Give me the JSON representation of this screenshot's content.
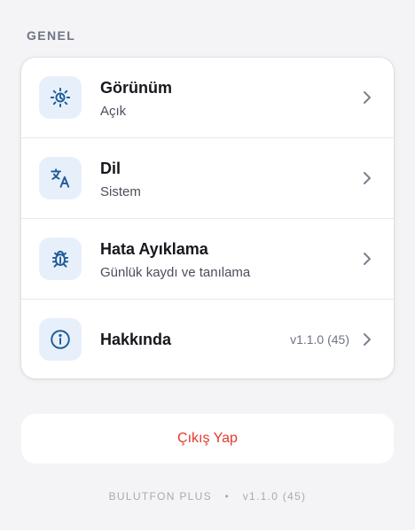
{
  "section": {
    "title": "GENEL"
  },
  "rows": [
    {
      "title": "Görünüm",
      "subtitle": "Açık",
      "icon": "theme-icon"
    },
    {
      "title": "Dil",
      "subtitle": "Sistem",
      "icon": "translate-icon"
    },
    {
      "title": "Hata Ayıklama",
      "subtitle": "Günlük kaydı ve tanılama",
      "icon": "bug-icon"
    },
    {
      "title": "Hakkında",
      "value": "v1.1.0 (45)",
      "icon": "info-icon"
    }
  ],
  "logout": {
    "label": "Çıkış Yap"
  },
  "footer": {
    "app_name": "BULUTFON PLUS",
    "separator": "•",
    "version": "v1.1.0 (45)"
  },
  "colors": {
    "accent": "#1f5c99",
    "icon_bg": "#e7f0fa",
    "danger": "#e5392b"
  }
}
